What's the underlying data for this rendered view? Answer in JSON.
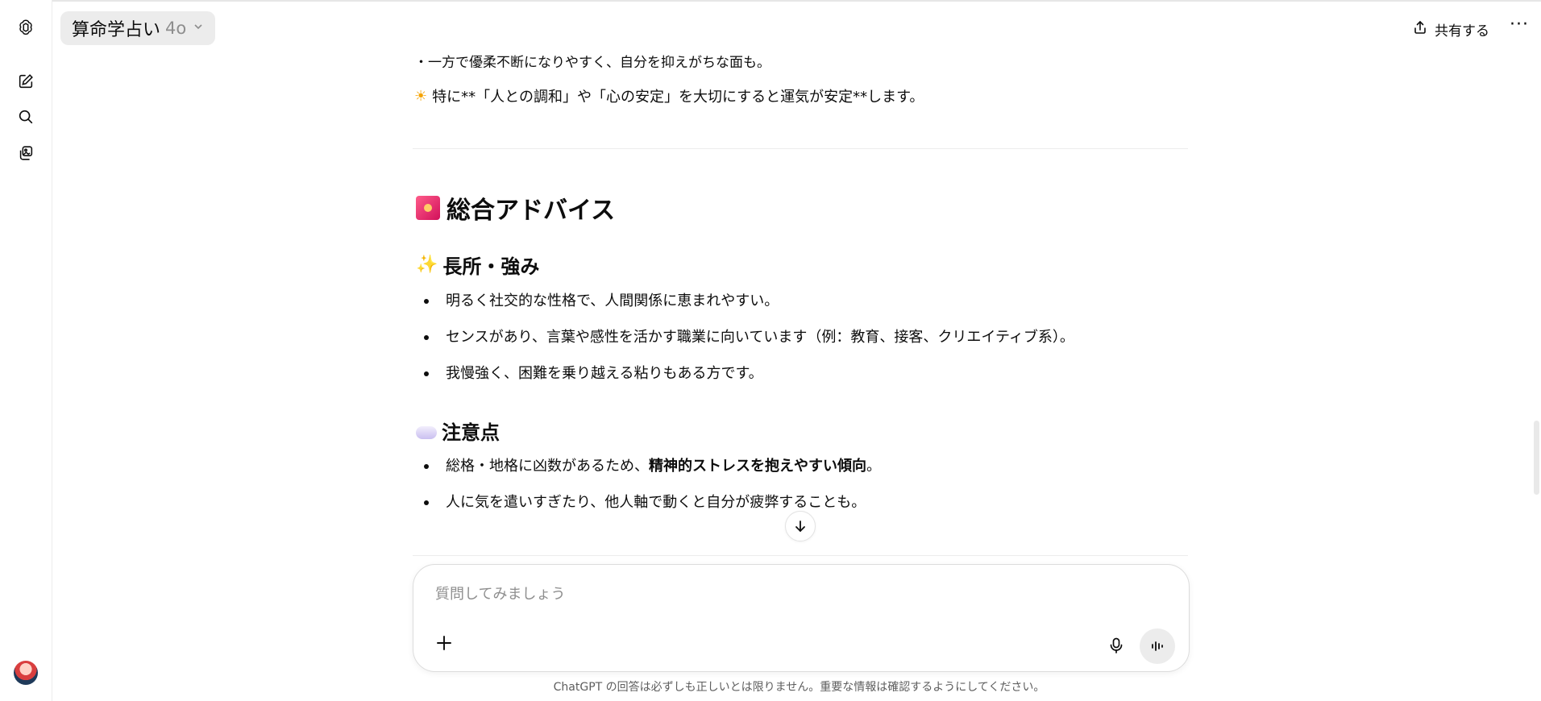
{
  "header": {
    "title": "算命学占い",
    "model": "4o",
    "share_label": "共有する",
    "more": "···"
  },
  "sidebar": {
    "icons": [
      "chatgpt-logo-icon",
      "new-chat-icon",
      "search-icon",
      "library-icon"
    ]
  },
  "conversation": {
    "cut_line": "・一方で優柔不断になりやすく、自分を抑えがちな面も。",
    "highlight_line": "特に**「人との調和」や「心の安定」を大切にすると運気が安定**します。",
    "section_title": "総合アドバイス",
    "strengths": {
      "title": "長所・強み",
      "items": [
        "明るく社交的な性格で、人間関係に恵まれやすい。",
        "センスがあり、言葉や感性を活かす職業に向いています（例：教育、接客、クリエイティブ系）。",
        "我慢強く、困難を乗り越える粘りもある方です。"
      ]
    },
    "cautions": {
      "title": "注意点",
      "item1_plain": "総格・地格に凶数があるため、",
      "item1_bold": "精神的ストレスを抱えやすい傾向",
      "item1_end": "。",
      "item2": "人に気を遣いすぎたり、他人軸で動くと自分が疲弊することも。"
    }
  },
  "composer": {
    "placeholder": "質問してみましょう"
  },
  "footer": {
    "disclaimer": "ChatGPT の回答は必ずしも正しいとは限りません。重要な情報は確認するようにしてください。"
  }
}
